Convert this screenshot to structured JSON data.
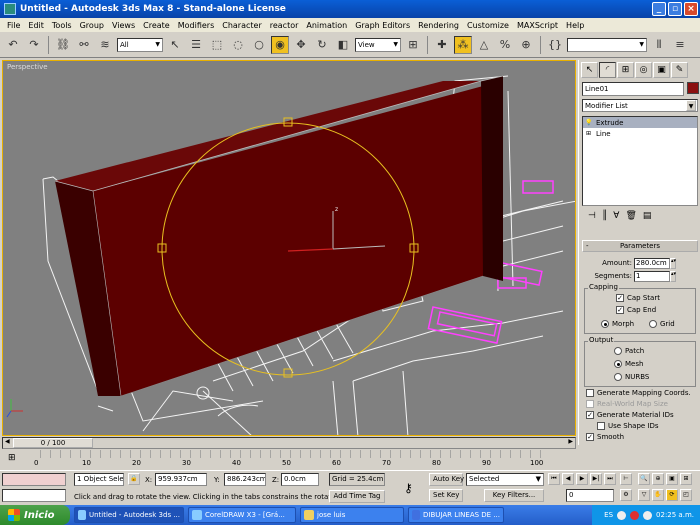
{
  "window": {
    "title": "Untitled - Autodesk 3ds Max 8 - Stand-alone License"
  },
  "menu": [
    "File",
    "Edit",
    "Tools",
    "Group",
    "Views",
    "Create",
    "Modifiers",
    "Character",
    "reactor",
    "Animation",
    "Graph Editors",
    "Rendering",
    "Customize",
    "MAXScript",
    "Help"
  ],
  "toolbar": {
    "selection_filter": "All",
    "ref_coord": "View"
  },
  "viewport": {
    "label": "Perspective"
  },
  "cmdpanel": {
    "object_name": "Line01",
    "modifier_list": "Modifier List",
    "stack": [
      "Extrude",
      "Line"
    ],
    "parameters": {
      "rollout_title": "Parameters",
      "amount_label": "Amount:",
      "amount_value": "280.0cm",
      "segments_label": "Segments:",
      "segments_value": "1",
      "capping_title": "Capping",
      "cap_start": "Cap Start",
      "cap_end": "Cap End",
      "morph": "Morph",
      "grid": "Grid",
      "output_title": "Output",
      "patch": "Patch",
      "mesh": "Mesh",
      "nurbs": "NURBS",
      "gen_mapping": "Generate Mapping Coords.",
      "real_world": "Real-World Map Size",
      "gen_matids": "Generate Material IDs",
      "use_shape_ids": "Use Shape IDs",
      "smooth": "Smooth"
    }
  },
  "timeline": {
    "slider": "0 / 100",
    "ticks": [
      "0",
      "10",
      "20",
      "30",
      "40",
      "50",
      "60",
      "70",
      "80",
      "90",
      "100"
    ]
  },
  "status": {
    "selection": "1 Object Sele",
    "x_label": "X:",
    "x_value": "959.937cm",
    "y_label": "Y:",
    "y_value": "886.243cm",
    "z_label": "Z:",
    "z_value": "0.0cm",
    "grid": "Grid = 25.4cm",
    "prompt": "Click and drag to rotate the view.  Clicking in the tabs constrains the rotation",
    "add_time_tag": "Add Time Tag",
    "auto_key": "Auto Key",
    "set_key": "Set Key",
    "key_mode": "Selected",
    "key_filters": "Key Filters...",
    "frame": "0"
  },
  "taskbar": {
    "start": "Inicio",
    "tasks": [
      "Untitled - Autodesk 3ds ...",
      "CorelDRAW X3 - [Grá...",
      "jose luis",
      "DIBUJAR LINEAS DE ..."
    ],
    "lang": "ES",
    "clock": "02:25 a.m."
  },
  "colors": {
    "wall": "#5c0000",
    "wall_side": "#3a0000",
    "spline": "#ff40ff",
    "gizmo": "#e8c020"
  }
}
